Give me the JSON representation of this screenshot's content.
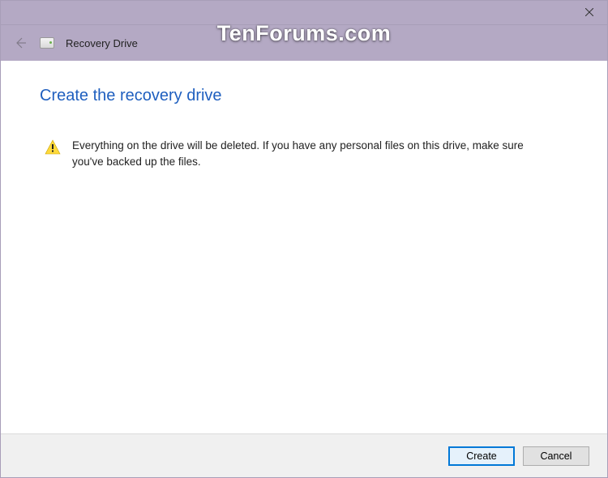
{
  "window": {
    "app_name": "Recovery Drive"
  },
  "page": {
    "title": "Create the recovery drive",
    "warning_text": "Everything on the drive will be deleted. If you have any personal files on this drive, make sure you've backed up the files."
  },
  "footer": {
    "primary_label": "Create",
    "cancel_label": "Cancel"
  },
  "watermark": "TenForums.com"
}
